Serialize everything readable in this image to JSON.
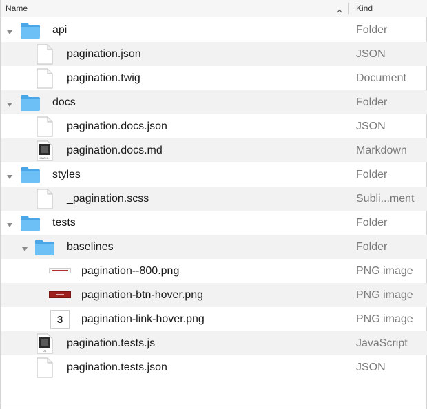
{
  "header": {
    "name_label": "Name",
    "kind_label": "Kind",
    "sort_icon": "chevron-up-icon"
  },
  "rows": [
    {
      "name": "api",
      "kind": "Folder",
      "icon": "folder-icon",
      "expanded": true
    },
    {
      "name": "pagination.json",
      "kind": "JSON",
      "icon": "document-icon"
    },
    {
      "name": "pagination.twig",
      "kind": "Document",
      "icon": "document-icon"
    },
    {
      "name": "docs",
      "kind": "Folder",
      "icon": "folder-icon",
      "expanded": true
    },
    {
      "name": "pagination.docs.json",
      "kind": "JSON",
      "icon": "document-icon"
    },
    {
      "name": "pagination.docs.md",
      "kind": "Markdown",
      "icon": "markdown-file-icon",
      "icon_badge": "MARK..."
    },
    {
      "name": "styles",
      "kind": "Folder",
      "icon": "folder-icon",
      "expanded": true
    },
    {
      "name": "_pagination.scss",
      "kind": "Subli...ment",
      "icon": "document-icon"
    },
    {
      "name": "tests",
      "kind": "Folder",
      "icon": "folder-icon",
      "expanded": true
    },
    {
      "name": "baselines",
      "kind": "Folder",
      "icon": "folder-icon",
      "expanded": true
    },
    {
      "name": "pagination--800.png",
      "kind": "PNG image",
      "icon": "image-thumbnail-icon"
    },
    {
      "name": "pagination-btn-hover.png",
      "kind": "PNG image",
      "icon": "image-thumbnail-icon"
    },
    {
      "name": "pagination-link-hover.png",
      "kind": "PNG image",
      "icon": "image-thumbnail-icon",
      "icon_text": "3"
    },
    {
      "name": "pagination.tests.js",
      "kind": "JavaScript",
      "icon": "javascript-file-icon",
      "icon_badge": "JS"
    },
    {
      "name": "pagination.tests.json",
      "kind": "JSON",
      "icon": "document-icon"
    }
  ],
  "colors": {
    "folder": "#66b9f2",
    "folder_dark": "#4aa6e6",
    "row_alt": "#f2f2f2",
    "kind_text": "#7a7a7a"
  }
}
